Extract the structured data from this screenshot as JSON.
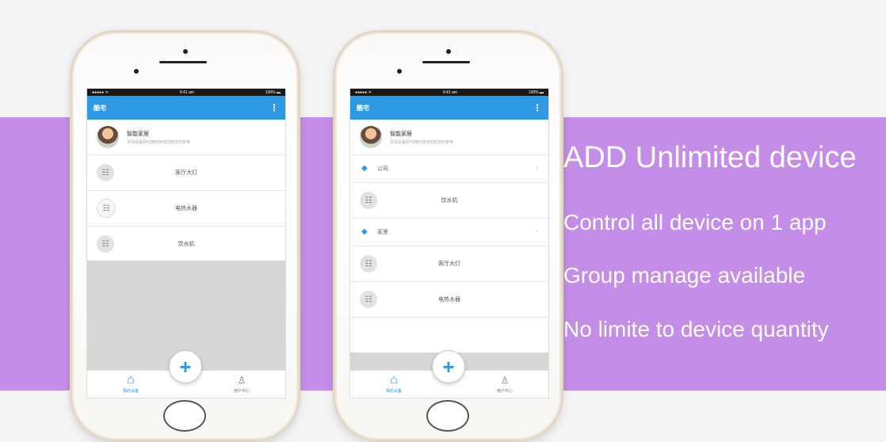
{
  "features": [
    "ADD  Unlimited device",
    "Control all device on 1 app",
    "Group manage available",
    "No limite to device quantity"
  ],
  "phone_left": {
    "status": {
      "carrier": "●●●●● ᯤ",
      "time": "9:41 am",
      "battery": "100% ▬"
    },
    "app_title": "酷宅",
    "menu_icon": "more-vert-icon",
    "profile": {
      "name": "智能家居",
      "subtitle": "添加设备即可随时随地控制您的家电"
    },
    "devices": [
      {
        "label": "客厅大灯",
        "icon": "plug-icon"
      },
      {
        "label": "电热水器",
        "icon": "plug-icon"
      },
      {
        "label": "饮水机",
        "icon": "plug-icon"
      }
    ],
    "nav": {
      "home_label": "我的设备",
      "user_label": "用户中心",
      "fab_label": "+"
    }
  },
  "phone_right": {
    "status": {
      "carrier": "●●●●● ᯤ",
      "time": "9:41 am",
      "battery": "100% ▬"
    },
    "app_title": "酷宅",
    "menu_icon": "more-vert-icon",
    "profile": {
      "name": "智能家居",
      "subtitle": "添加设备即可随时随地控制您的家电"
    },
    "groups": [
      {
        "name": "公司",
        "devices": [
          {
            "label": "饮水机",
            "icon": "plug-icon"
          }
        ]
      },
      {
        "name": "家里",
        "devices": [
          {
            "label": "客厅大灯",
            "icon": "plug-icon"
          },
          {
            "label": "电热水器",
            "icon": "plug-icon"
          }
        ]
      }
    ],
    "nav": {
      "home_label": "我的设备",
      "user_label": "用户中心",
      "fab_label": "+"
    }
  },
  "colors": {
    "band": "#c58ee8",
    "appbar": "#2e9ae6",
    "accent": "#2a9ae4",
    "text": "#ffffff"
  }
}
